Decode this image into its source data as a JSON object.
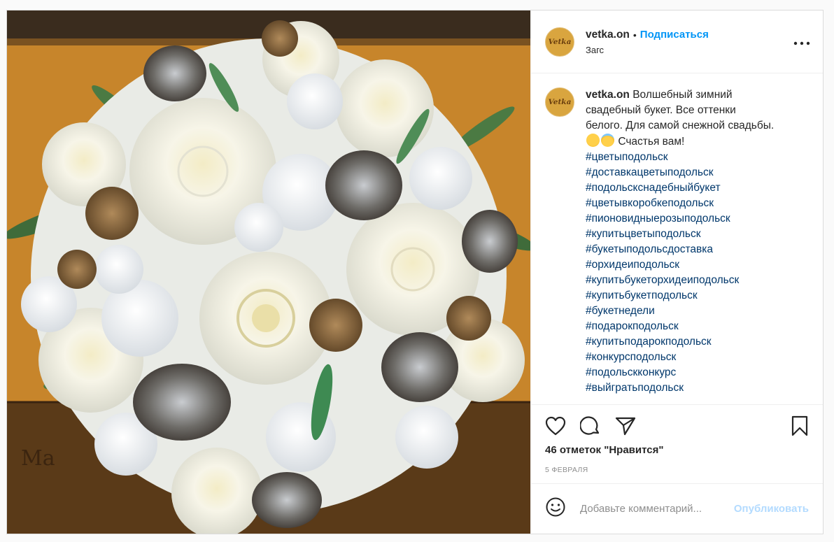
{
  "account": {
    "username": "vetka.on",
    "avatar_text": "Vetka",
    "follow_label": "Подписаться",
    "location": "Загс"
  },
  "caption": {
    "username": "vetka.on",
    "text_before_emoji": "Волшебный зимний свадебный букет. Все оттенки белого. Для самой снежной свадьбы.",
    "text_after_emoji": "Счастья вам!",
    "emojis": [
      "hugging-face-emoji",
      "angel-emoji"
    ],
    "hashtags": [
      "#цветыподольск",
      "#доставкацветыподольск",
      "#подольскснадебныйбукет",
      "#цветывкоробкеподольск",
      "#пионовидныерозыподольск",
      "#купитьцветыподольск",
      "#букетыподольсдоставка",
      "#орхидеиподольск",
      "#купитьбукеторхидеиподольск",
      "#купитьбукетподольск",
      "#букетнедели",
      "#подарокподольск",
      "#купитьподарокподольск",
      "#конкурсподольск",
      "#подольскконкурс",
      "#выйгратьподольск"
    ]
  },
  "actions": {
    "likes_text": "46 отметок \"Нравится\"",
    "date": "5 ФЕВРАЛЯ"
  },
  "comment": {
    "placeholder": "Добавьте комментарий...",
    "publish_label": "Опубликовать"
  },
  "colors": {
    "link_blue": "#0095f6",
    "hashtag": "#00376b",
    "publish_disabled": "#b3dbff"
  }
}
